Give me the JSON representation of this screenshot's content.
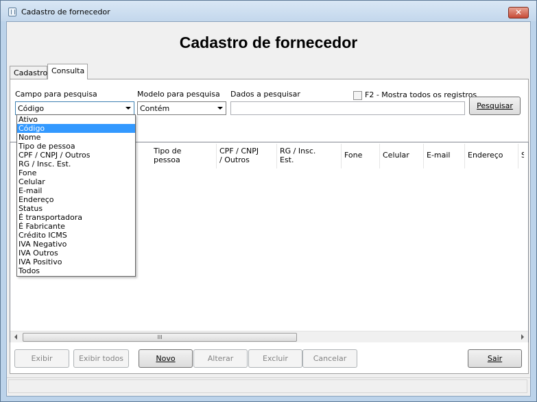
{
  "window": {
    "title": "Cadastro de fornecedor",
    "close_label": "✕"
  },
  "header": {
    "title": "Cadastro de fornecedor"
  },
  "tabs": [
    {
      "label": "Cadastro"
    },
    {
      "label": "Consulta"
    }
  ],
  "search": {
    "field_label": "Campo para pesquisa",
    "field_value": "Código",
    "model_label": "Modelo para pesquisa",
    "model_value": "Contém",
    "data_label": "Dados a pesquisar",
    "data_value": "",
    "show_all_label": "F2 - Mostra todos os registros",
    "search_button": "Pesquisar"
  },
  "dropdown_options": [
    "Ativo",
    "Código",
    "Nome",
    "Tipo de pessoa",
    "CPF / CNPJ / Outros",
    "RG / Insc. Est.",
    "Fone",
    "Celular",
    "E-mail",
    "Endereço",
    "Status",
    "É transportadora",
    "É Fabricante",
    "Crédito ICMS",
    "IVA Negativo",
    "IVA Outros",
    "IVA Positivo",
    "Todos"
  ],
  "dropdown_selected": "Código",
  "grid": {
    "columns": [
      {
        "label": "Tipo de\npessoa"
      },
      {
        "label": "CPF / CNPJ\n/ Outros"
      },
      {
        "label": "RG / Insc.\nEst."
      },
      {
        "label": "Fone"
      },
      {
        "label": "Celular"
      },
      {
        "label": "E-mail"
      },
      {
        "label": "Endereço"
      },
      {
        "label": "S"
      }
    ],
    "scroll_grip": "III"
  },
  "buttons": {
    "exibir": "Exibir",
    "exibir_todos": "Exibir todos",
    "novo": "Novo",
    "alterar": "Alterar",
    "excluir": "Excluir",
    "cancelar": "Cancelar",
    "sair": "Sair"
  }
}
